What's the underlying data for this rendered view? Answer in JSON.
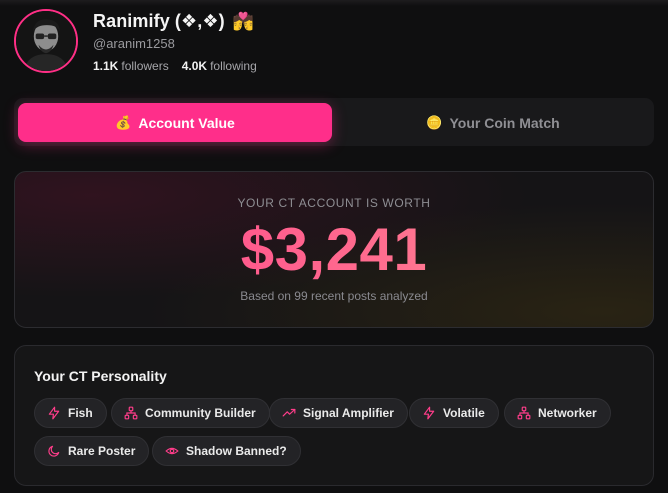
{
  "profile": {
    "name": "Ranimify (❖,❖)",
    "badge_emoji": "💏",
    "handle": "@aranim1258",
    "followers_count": "1.1K",
    "followers_label": "followers",
    "following_count": "4.0K",
    "following_label": "following"
  },
  "tabs": [
    {
      "label": "Account Value",
      "icon": "money-bag-icon",
      "glyph": "💰",
      "active": true
    },
    {
      "label": "Your Coin Match",
      "icon": "coin-icon",
      "glyph": "🪙",
      "active": false
    }
  ],
  "value_card": {
    "label": "YOUR CT ACCOUNT IS WORTH",
    "amount": "$3,241",
    "subtitle": "Based on 99 recent posts analyzed"
  },
  "personality": {
    "title": "Your CT Personality",
    "traits": [
      {
        "label": "Fish",
        "icon": "lightning-icon"
      },
      {
        "label": "Community Builder",
        "icon": "network-icon"
      },
      {
        "label": "Signal Amplifier",
        "icon": "trend-up-icon"
      },
      {
        "label": "Volatile",
        "icon": "lightning-icon"
      },
      {
        "label": "Networker",
        "icon": "network-icon"
      },
      {
        "label": "Rare Poster",
        "icon": "moon-icon"
      },
      {
        "label": "Shadow Banned?",
        "icon": "eye-icon"
      }
    ]
  },
  "colors": {
    "accent": "#ff2e8a",
    "background": "#0f0f10",
    "card": "#161617"
  }
}
